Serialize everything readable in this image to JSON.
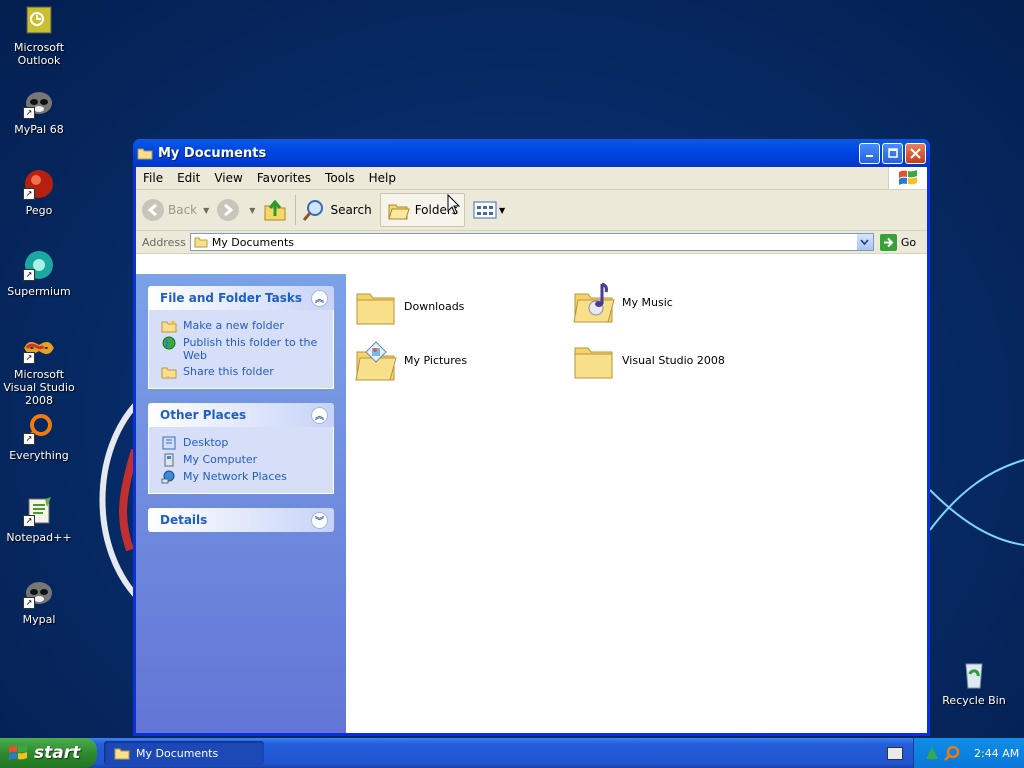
{
  "desktop": {
    "icons": [
      {
        "label": "Microsoft Outlook"
      },
      {
        "label": "MyPal 68"
      },
      {
        "label": "Pego"
      },
      {
        "label": "Supermium"
      },
      {
        "label": "Microsoft Visual Studio 2008"
      },
      {
        "label": "Everything"
      },
      {
        "label": "Notepad++"
      },
      {
        "label": "Mypal"
      }
    ],
    "recycle_bin": "Recycle Bin"
  },
  "window": {
    "title": "My Documents",
    "menu": [
      "File",
      "Edit",
      "View",
      "Favorites",
      "Tools",
      "Help"
    ],
    "toolbar": {
      "back": "Back",
      "search": "Search",
      "folders": "Folders"
    },
    "address": {
      "label": "Address",
      "value": "My Documents",
      "go": "Go"
    },
    "panels": {
      "file_tasks": {
        "title": "File and Folder Tasks",
        "links": [
          "Make a new folder",
          "Publish this folder to the Web",
          "Share this folder"
        ]
      },
      "other_places": {
        "title": "Other Places",
        "links": [
          "Desktop",
          "My Computer",
          "My Network Places"
        ]
      },
      "details": {
        "title": "Details"
      }
    },
    "files": [
      "Downloads",
      "My Music",
      "My Pictures",
      "Visual Studio 2008"
    ]
  },
  "taskbar": {
    "start": "start",
    "task": "My Documents",
    "clock": "2:44 AM"
  },
  "colors": {
    "title_blue": "#0831d9",
    "link_blue": "#215dc6",
    "start_green": "#2e8a2e"
  }
}
